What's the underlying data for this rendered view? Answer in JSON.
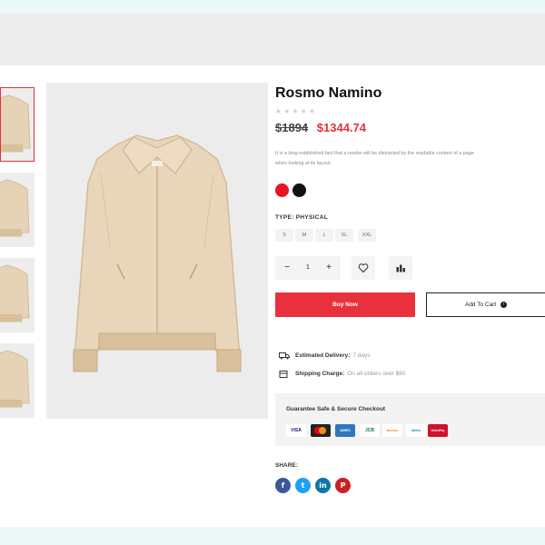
{
  "product": {
    "title": "Rosmo Namino",
    "rating_stars": "★★★★★",
    "old_price": "$1894",
    "new_price": "$1344.74",
    "description_line1": "It is a long established fact that a reader will be distracted by the readable content of a page",
    "description_line2": "when looking at its layout.",
    "colors": [
      "#e8141f",
      "#111111"
    ],
    "type_label": "TYPE: PHYSICAL",
    "sizes": [
      "S",
      "M",
      "L",
      "XL",
      "XXL"
    ],
    "quantity": "1",
    "minus": "−",
    "plus": "+"
  },
  "actions": {
    "buy_now": "Buy Now",
    "add_to_cart": "Add To Cart",
    "cart_arrow": "›"
  },
  "delivery": {
    "estimated_label": "Estimated Delivery:",
    "estimated_value": "7 days",
    "shipping_label": "Shipping Charge:",
    "shipping_value": "On all orders over $60"
  },
  "checkout": {
    "title": "Guarantee Safe & Secure Checkout",
    "cards": [
      "VISA",
      "mastercard",
      "AMEX",
      "JCB",
      "discover",
      "diners",
      "UnionPay"
    ]
  },
  "share": {
    "label": "SHARE:",
    "networks": [
      {
        "icon": "f",
        "name": "facebook",
        "color": "#3b5998"
      },
      {
        "icon": "t",
        "name": "twitter",
        "color": "#1da1f2"
      },
      {
        "icon": "in",
        "name": "linkedin",
        "color": "#0e76a8"
      },
      {
        "icon": "P",
        "name": "pinterest",
        "color": "#cb2027"
      }
    ]
  },
  "colors": {
    "accent_red": "#e9313d",
    "price_red": "#e5313a"
  }
}
